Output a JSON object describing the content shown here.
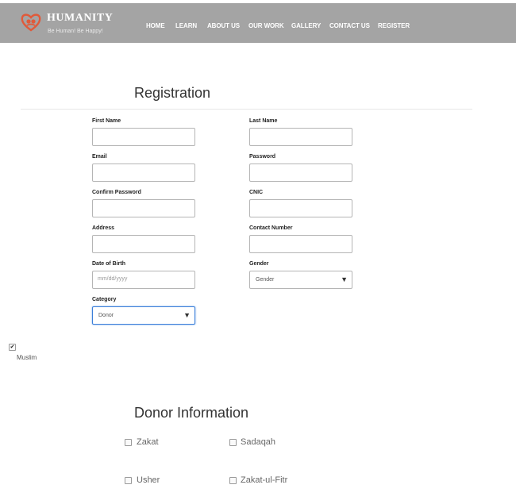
{
  "brand": {
    "name": "HUMANITY",
    "tagline": "Be Human! Be Happy!",
    "logo_color": "#e05a3a"
  },
  "nav": {
    "items": [
      {
        "label": "HOME"
      },
      {
        "label": "LEARN"
      },
      {
        "label": "ABOUT US"
      },
      {
        "label": "OUR WORK"
      },
      {
        "label": "GALLERY"
      },
      {
        "label": "CONTACT US"
      },
      {
        "label": "REGISTER"
      }
    ],
    "background": "#a4a4a4"
  },
  "registration": {
    "title": "Registration",
    "fields": {
      "first_name": {
        "label": "First Name",
        "value": ""
      },
      "last_name": {
        "label": "Last Name",
        "value": ""
      },
      "email": {
        "label": "Email",
        "value": ""
      },
      "password": {
        "label": "Password",
        "value": ""
      },
      "confirm_password": {
        "label": "Confirm Password",
        "value": ""
      },
      "cnic": {
        "label": "CNIC",
        "value": ""
      },
      "address": {
        "label": "Address",
        "value": ""
      },
      "contact_number": {
        "label": "Contact Number",
        "value": ""
      },
      "dob": {
        "label": "Date of Birth",
        "placeholder": "mm/dd/yyyy"
      },
      "gender": {
        "label": "Gender",
        "selected": "Gender"
      },
      "category": {
        "label": "Category",
        "selected": "Donor"
      }
    },
    "muslim": {
      "label": "Muslim",
      "checked": true
    }
  },
  "donor": {
    "title": "Donor Information",
    "options": [
      {
        "label": "Zakat",
        "checked": false
      },
      {
        "label": "Sadaqah",
        "checked": false
      },
      {
        "label": "Usher",
        "checked": false
      },
      {
        "label": "Zakat-ul-Fitr",
        "checked": false
      }
    ]
  }
}
